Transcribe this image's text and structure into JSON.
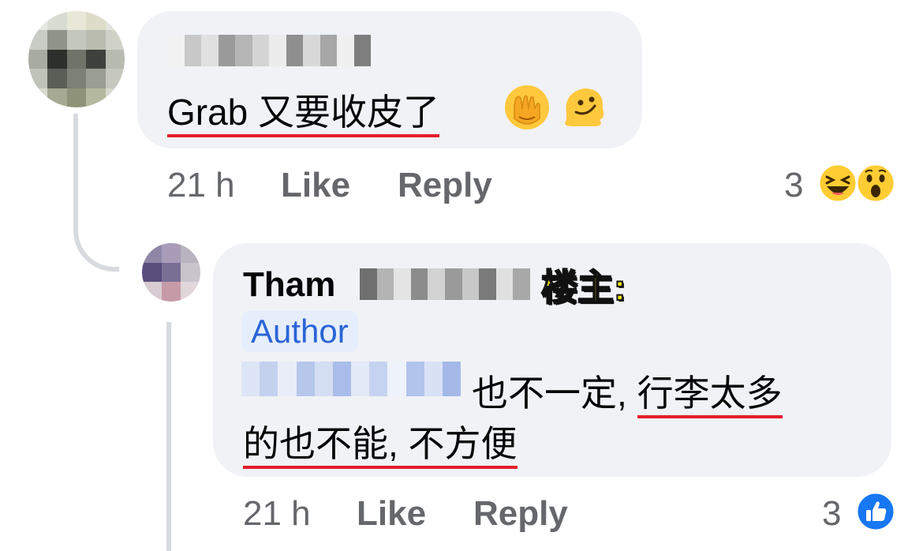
{
  "comment1": {
    "text_prefix": "Grab ",
    "text_underlined": "又要收皮了",
    "emojis": [
      "face-with-hand-over-mouth-emoji",
      "melting-face-emoji"
    ],
    "time": "21 h",
    "like_label": "Like",
    "reply_label": "Reply",
    "reaction_count": "3",
    "reactions": [
      "laughing-reaction",
      "wow-reaction"
    ]
  },
  "comment2": {
    "author_first_name": "Tham",
    "op_label": "楼主:",
    "author_badge": "Author",
    "text_part1": "也不一定, ",
    "text_part2_underlined": "行李太多",
    "text_line2_underlined": "的也不能, 不方便",
    "time": "21 h",
    "like_label": "Like",
    "reply_label": "Reply",
    "reaction_count": "3",
    "reactions": [
      "like-reaction"
    ]
  },
  "colors": {
    "bubble_bg": "#f0f2f5",
    "meta_text": "#65676b",
    "author_badge_bg": "#e6eefc",
    "author_badge_text": "#2a64d6",
    "underline": "#e41e2b",
    "op_label": "#ffeb12",
    "like_blue": "#1877f2"
  }
}
